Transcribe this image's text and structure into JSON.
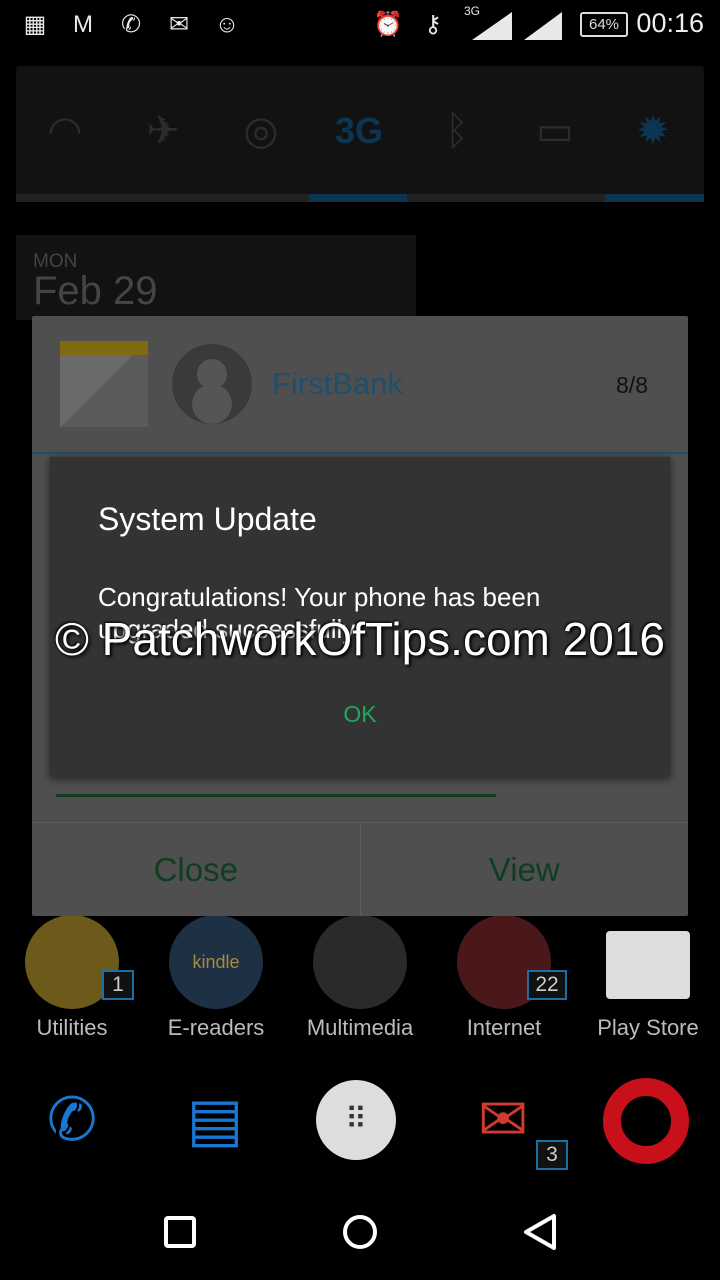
{
  "status_bar": {
    "left_icons": [
      "blackberry-messenger-icon",
      "app-m-icon",
      "whatsapp-icon",
      "gmail-icon",
      "messaging-icon"
    ],
    "right_icons": [
      "alarm-icon",
      "vpn-key-icon",
      "signal-3g-icon",
      "signal-icon"
    ],
    "network": "3G",
    "battery": "64%",
    "time": "00:16"
  },
  "quick_settings": {
    "tiles": [
      {
        "icon": "wifi-icon",
        "active": false
      },
      {
        "icon": "airplane-icon",
        "active": false
      },
      {
        "icon": "hotspot-icon",
        "active": false
      },
      {
        "icon": "mobile-data-3g-icon",
        "label": "3G",
        "active": true
      },
      {
        "icon": "bluetooth-icon",
        "active": false
      },
      {
        "icon": "battery-saver-icon",
        "active": false
      },
      {
        "icon": "auto-brightness-icon",
        "label": "A",
        "active": true
      }
    ],
    "accent": "#0b3552"
  },
  "date_widget": {
    "day": "MON",
    "date": "Feb 29"
  },
  "notification": {
    "sender": "FirstBank",
    "counter": "8/8",
    "close_label": "Close",
    "view_label": "View"
  },
  "dialog": {
    "title": "System Update",
    "message": "Congratulations! Your phone has been upgraded successfully.",
    "ok_label": "OK",
    "ok_color": "#1fa85a"
  },
  "watermark": "© PatchworkOfTips.com 2016",
  "home": {
    "apps": [
      {
        "label": "Utilities",
        "badge": "1"
      },
      {
        "label": "E-readers",
        "icon_text": "kindle"
      },
      {
        "label": "Multimedia"
      },
      {
        "label": "Internet",
        "badge": "22"
      },
      {
        "label": "Play Store"
      }
    ],
    "dock": [
      {
        "icon": "phone-icon"
      },
      {
        "icon": "messenger-icon"
      },
      {
        "icon": "app-drawer-icon"
      },
      {
        "icon": "gmail-icon",
        "badge": "3"
      },
      {
        "icon": "opera-icon"
      }
    ]
  }
}
